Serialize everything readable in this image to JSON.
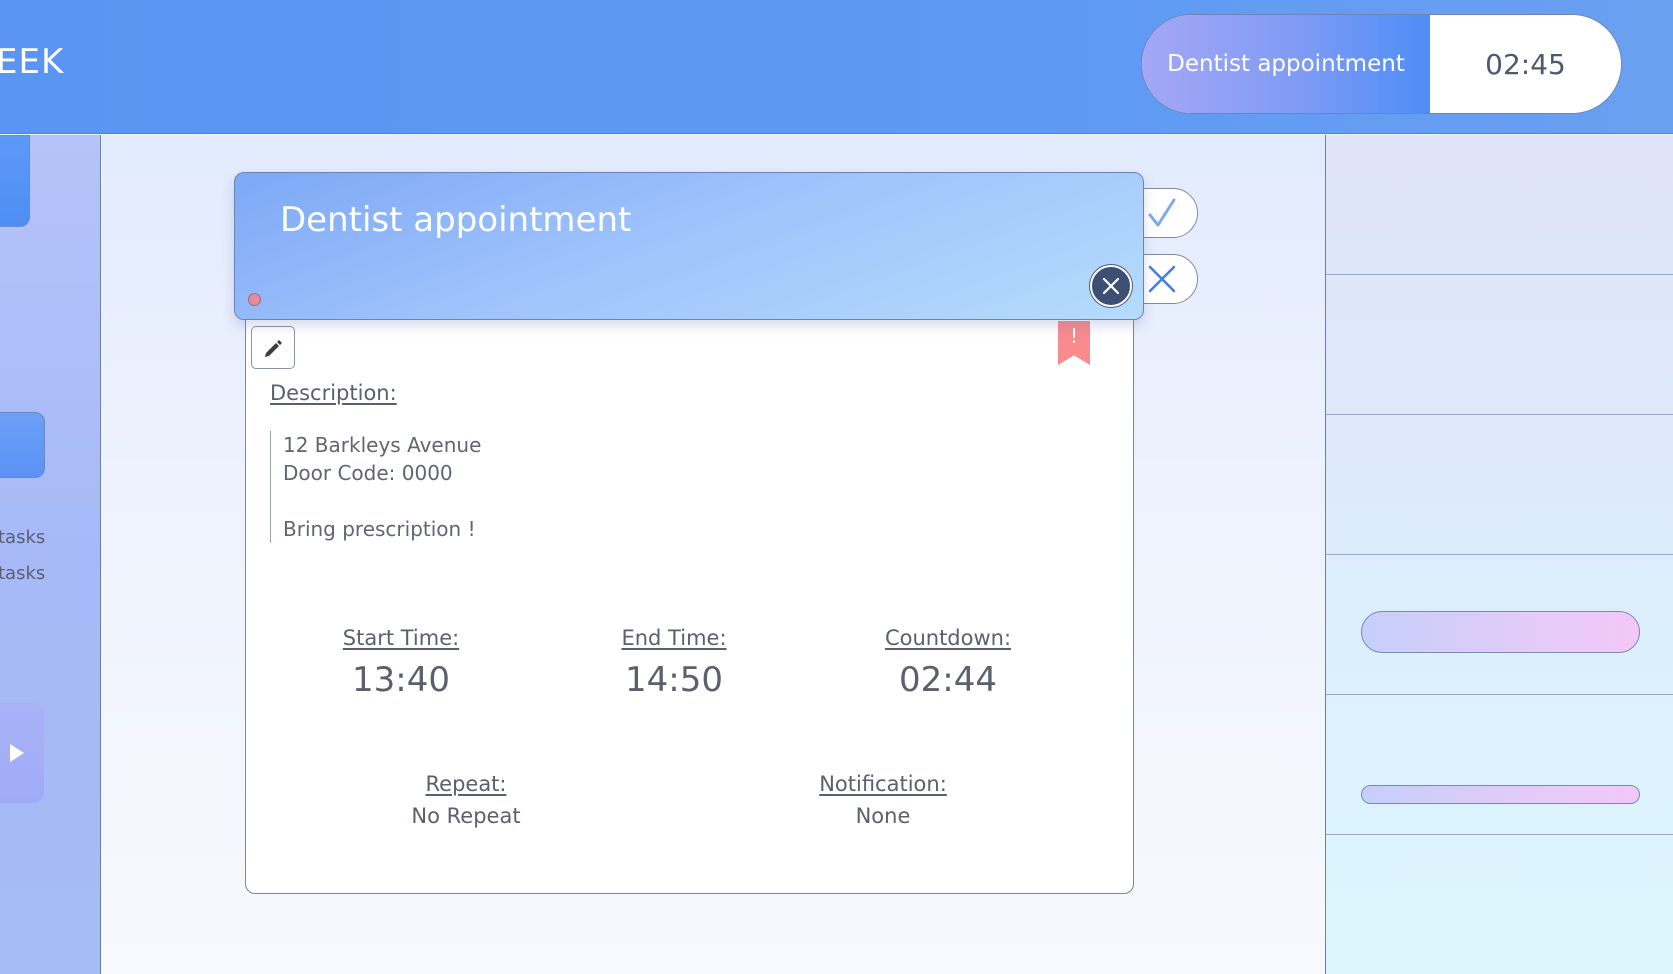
{
  "header": {
    "title": "EEK",
    "active_task": "Dentist appointment",
    "active_time": "02:45"
  },
  "sidebar": {
    "line1": "tasks",
    "line2": "tasks"
  },
  "task": {
    "title": "Dentist appointment",
    "description_label": "Description:",
    "description_lines": [
      "12 Barkleys Avenue",
      "Door Code: 0000",
      "",
      "Bring prescription !"
    ],
    "priority_mark": "!",
    "start_label": "Start Time:",
    "start_value": "13:40",
    "end_label": "End Time:",
    "end_value": "14:50",
    "countdown_label": "Countdown:",
    "countdown_value": "02:44",
    "repeat_label": "Repeat:",
    "repeat_value": "No Repeat",
    "notification_label": "Notification:",
    "notification_value": "None"
  },
  "colors": {
    "header_blue": "#5b95f3",
    "close_button": "#3d4f72",
    "priority_flag": "#f98a8e"
  },
  "icons": [
    "checkmark-icon",
    "x-icon",
    "close-icon",
    "pencil-icon",
    "bookmark-flag-icon",
    "play-icon"
  ]
}
